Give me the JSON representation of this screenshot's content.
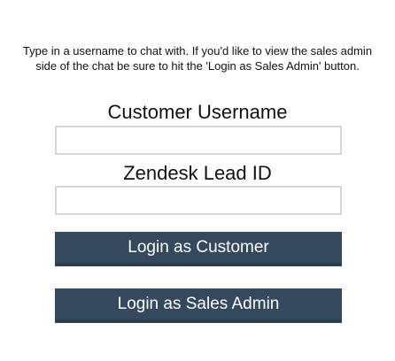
{
  "intro": {
    "text": "Type in a username to chat with. If you'd like to view the sales admin side of the chat be sure to hit the 'Login as Sales Admin' button."
  },
  "form": {
    "username_label": "Customer Username",
    "username_value": "",
    "lead_label": "Zendesk Lead ID",
    "lead_value": ""
  },
  "buttons": {
    "customer_label": "Login as Customer",
    "admin_label": "Login as Sales Admin"
  },
  "colors": {
    "button_bg": "#34495e",
    "button_text": "#ffffff",
    "input_border": "#d6d6d6"
  }
}
